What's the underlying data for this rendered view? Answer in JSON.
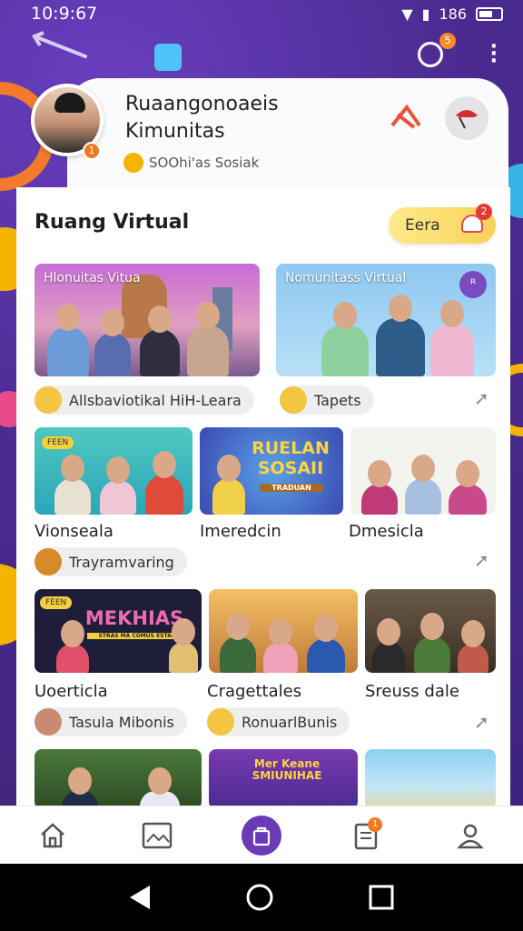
{
  "status_bar": {
    "time": "10:9:67",
    "signal": "186"
  },
  "top_bar": {
    "power_badge": "5"
  },
  "profile": {
    "name": "Ruaangonoaeis Kimunitas",
    "subtitle": "SOOhi'as Sosiak",
    "avatar_badge": "1"
  },
  "section": {
    "title": "Ruang Virtual",
    "action_label": "Eera",
    "action_badge": "2"
  },
  "row1": {
    "cards": [
      {
        "label": "Hlonuitas Vitua"
      },
      {
        "label": "Nomunitass Virtual"
      }
    ],
    "chips": [
      "Allsbaviotikal HiH-Leara",
      "Tapets"
    ]
  },
  "row2": {
    "cards": [
      {
        "label": "FEEN",
        "big": "RUELAN SOSAII",
        "small": "TRADUAN"
      },
      {
        "label": ""
      },
      {
        "label": ""
      }
    ],
    "captions": [
      "Vionseala",
      "Imeredcin",
      "Dmesicla"
    ],
    "chips": [
      "Trayramvaring"
    ]
  },
  "row3": {
    "cards": [
      {
        "label": "FEEN",
        "big": "MEKHIAS",
        "small": "STRAS MA COMUS ESTAU"
      },
      {
        "label": ""
      },
      {
        "label": ""
      }
    ],
    "captions": [
      "Uoerticla",
      "Cragettales",
      "Sreuss dale"
    ],
    "chips": [
      "Tasula Mibonis",
      "RonuarlBunis"
    ]
  },
  "row4": {
    "cards": [
      {
        "label": ""
      },
      {
        "label": "",
        "big": "Mer Keane SMIUNIHAE"
      },
      {
        "label": ""
      }
    ]
  },
  "bottom_nav": {
    "items": [
      "home-icon",
      "gallery-icon",
      "bag-icon",
      "clipboard-icon",
      "profile-icon"
    ],
    "badge": "1"
  },
  "colors": {
    "accent": "#6a3ab8",
    "background": "#4a2a8f",
    "pill": "#f8d25a",
    "badge": "#f0781e"
  }
}
